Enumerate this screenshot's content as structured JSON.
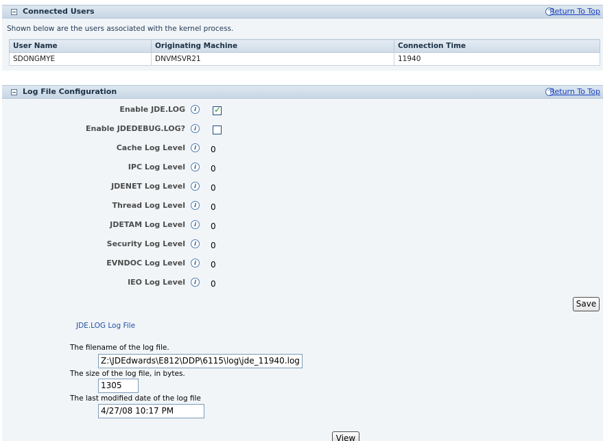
{
  "connected_users": {
    "title": "Connected Users",
    "return_link": "Return To Top",
    "description": "Shown below are the users associated with the kernel process.",
    "columns": [
      "User Name",
      "Originating Machine",
      "Connection Time"
    ],
    "rows": [
      [
        "SDONGMYE",
        "DNVMSVR21",
        "11940"
      ]
    ]
  },
  "log_config": {
    "title": "Log File Configuration",
    "return_link": "Return To Top",
    "enable_jde_log": {
      "label": "Enable JDE.LOG",
      "checked": true
    },
    "enable_jdedebug_log": {
      "label": "Enable JDEDEBUG.LOG?",
      "checked": false
    },
    "levels": [
      {
        "label": "Cache Log Level",
        "value": "0"
      },
      {
        "label": "IPC Log Level",
        "value": "0"
      },
      {
        "label": "JDENET Log Level",
        "value": "0"
      },
      {
        "label": "Thread Log Level",
        "value": "0"
      },
      {
        "label": "JDETAM Log Level",
        "value": "0"
      },
      {
        "label": "Security Log Level",
        "value": "0"
      },
      {
        "label": "EVNDOC Log Level",
        "value": "0"
      },
      {
        "label": "IEO Log Level",
        "value": "0"
      }
    ],
    "save_label": "Save"
  },
  "log_file": {
    "heading": "JDE.LOG Log File",
    "filename_label": "The filename of the log file.",
    "filename_value": "Z:\\JDEdwards\\E812\\DDP\\6115\\log\\jde_11940.log",
    "size_label": "The size of the log file, in bytes.",
    "size_value": "1305",
    "modified_label": "The last modified date of the log file",
    "modified_value": "4/27/08 10:17 PM",
    "view_label": "View"
  },
  "icons": {
    "collapse": "collapse-icon",
    "return_top": "chevron-up-icon",
    "info": "info-icon"
  }
}
